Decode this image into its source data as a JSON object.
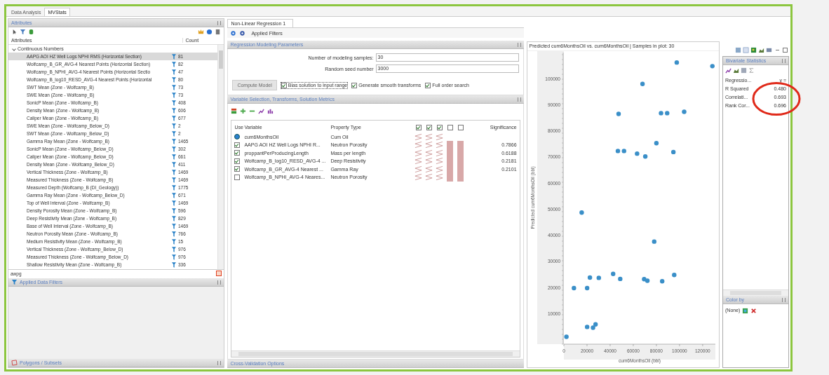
{
  "app_tabs": [
    {
      "label": "Data Analysis",
      "selected": false
    },
    {
      "label": "MVStats",
      "selected": true
    }
  ],
  "attributes_panel": {
    "title": "Attributes",
    "columns": [
      "Attributes",
      "Count"
    ],
    "group": "Continuous Numbers",
    "expanded": true,
    "rows": [
      {
        "name": "AAPG AOI HZ Well Logs NPHI RMS (Horizontal Section)",
        "count": "81",
        "selected": true
      },
      {
        "name": "Wolfcamp_B_GR_AVG-4 Nearest Points  (Horizontal Section)",
        "count": "82",
        "selected": false
      },
      {
        "name": "Wolfcamp_B_NPHI_AVG-4 Nearest Points  (Horizontal Sectio",
        "count": "47",
        "selected": false
      },
      {
        "name": "Wolfcamp_B_log10_RESD_AVG-4 Nearest Points  (Horizontal",
        "count": "80",
        "selected": false
      },
      {
        "name": "SWT Mean (Zone - Wolfcamp_B)",
        "count": "73",
        "selected": false
      },
      {
        "name": "SWE Mean (Zone - Wolfcamp_B)",
        "count": "73",
        "selected": false
      },
      {
        "name": "SonicP Mean (Zone - Wolfcamp_B)",
        "count": "408",
        "selected": false
      },
      {
        "name": "Density Mean (Zone - Wolfcamp_B)",
        "count": "606",
        "selected": false
      },
      {
        "name": "Caliper Mean (Zone - Wolfcamp_B)",
        "count": "677",
        "selected": false
      },
      {
        "name": "SWE Mean (Zone - Wolfcamp_Below_D)",
        "count": "2",
        "selected": false
      },
      {
        "name": "SWT Mean (Zone - Wolfcamp_Below_D)",
        "count": "2",
        "selected": false
      },
      {
        "name": "Gamma Ray Mean (Zone - Wolfcamp_B)",
        "count": "1465",
        "selected": false
      },
      {
        "name": "SonicP Mean (Zone - Wolfcamp_Below_D)",
        "count": "302",
        "selected": false
      },
      {
        "name": "Caliper Mean (Zone - Wolfcamp_Below_D)",
        "count": "661",
        "selected": false
      },
      {
        "name": "Density Mean (Zone - Wolfcamp_Below_D)",
        "count": "411",
        "selected": false
      },
      {
        "name": "Vertical Thickness (Zone - Wolfcamp_B)",
        "count": "1469",
        "selected": false
      },
      {
        "name": "Measured Thickness (Zone - Wolfcamp_B)",
        "count": "1469",
        "selected": false
      },
      {
        "name": "Measured Depth (Wolfcamp_B (DI_Geology))",
        "count": "1775",
        "selected": false
      },
      {
        "name": "Gamma Ray Mean (Zone - Wolfcamp_Below_D)",
        "count": "671",
        "selected": false
      },
      {
        "name": "Top of Well Interval (Zone - Wolfcamp_B)",
        "count": "1469",
        "selected": false
      },
      {
        "name": "Density Porosity Mean (Zone - Wolfcamp_B)",
        "count": "596",
        "selected": false
      },
      {
        "name": "Deep Resistivity Mean (Zone - Wolfcamp_B)",
        "count": "829",
        "selected": false
      },
      {
        "name": "Base of Well Interval (Zone - Wolfcamp_B)",
        "count": "1469",
        "selected": false
      },
      {
        "name": "Neutron Porosity Mean (Zone - Wolfcamp_B)",
        "count": "766",
        "selected": false
      },
      {
        "name": "Medium Resistivity Mean (Zone - Wolfcamp_B)",
        "count": "15",
        "selected": false
      },
      {
        "name": "Vertical Thickness (Zone - Wolfcamp_Below_D)",
        "count": "976",
        "selected": false
      },
      {
        "name": "Measured Thickness (Zone - Wolfcamp_Below_D)",
        "count": "976",
        "selected": false
      },
      {
        "name": "Shallow Resistivity Mean (Zone - Wolfcamp_B)",
        "count": "336",
        "selected": false
      }
    ],
    "filter": {
      "value": "awpg"
    }
  },
  "applied_data_filters": {
    "title": "Applied Data Filters"
  },
  "polygons_subsets": {
    "title": "Polygons / Subsets"
  },
  "document_tab": {
    "label": "Non-Linear Regression 1"
  },
  "toolbar": {
    "label": "Applied Filters"
  },
  "regression_parameters": {
    "title": "Regression Modeling Parameters",
    "fields": [
      {
        "label": "Number of modeling samples:",
        "value": "30"
      },
      {
        "label": "Random seed number",
        "value": "3000"
      }
    ],
    "compute_button": {
      "label": "Compute Model",
      "disabled": true
    },
    "options": [
      {
        "label": "Bias solution to input range",
        "checked": true
      },
      {
        "label": "Generate smooth transforms",
        "checked": true
      },
      {
        "label": "Full order search",
        "checked": true
      }
    ]
  },
  "variable_selection": {
    "title": "Variable Selection, Transforms, Solution Metrics",
    "columns": [
      "Use",
      "Variable",
      "Property Type",
      "Significance"
    ],
    "header_checks": [
      true,
      true,
      true,
      false,
      false
    ],
    "rows": [
      {
        "kind": "target",
        "variable": "cum6MonthsOil",
        "property": "Cum Oil",
        "cells": [
          {
            "kind": "wave"
          },
          {
            "kind": "wave"
          },
          {
            "kind": "wave"
          },
          {
            "kind": "blank"
          },
          {
            "kind": "blank"
          }
        ]
      },
      {
        "kind": "checkbox",
        "checked": true,
        "variable": "AAPG AOI HZ Well Logs NPHI R...",
        "property": "Neutron Porosity",
        "cells": [
          {
            "kind": "wave"
          },
          {
            "kind": "wave"
          },
          {
            "kind": "wave"
          },
          {
            "kind": "bar"
          },
          {
            "kind": "bar"
          }
        ],
        "significance": "0.7866"
      },
      {
        "kind": "checkbox",
        "checked": true,
        "variable": "proppantPerProducingLength",
        "property": "Mass per length",
        "cells": [
          {
            "kind": "wave"
          },
          {
            "kind": "wave"
          },
          {
            "kind": "wave"
          },
          {
            "kind": "bar"
          },
          {
            "kind": "bar"
          }
        ],
        "significance": "0.6188"
      },
      {
        "kind": "checkbox",
        "checked": true,
        "variable": "Wolfcamp_B_log10_RESD_AVG-4 ...",
        "property": "Deep Resistivity",
        "cells": [
          {
            "kind": "wave"
          },
          {
            "kind": "wave"
          },
          {
            "kind": "wave"
          },
          {
            "kind": "bar"
          },
          {
            "kind": "bar"
          }
        ],
        "significance": "0.2181"
      },
      {
        "kind": "checkbox",
        "checked": true,
        "variable": "Wolfcamp_B_GR_AVG-4 Nearest ...",
        "property": "Gamma Ray",
        "cells": [
          {
            "kind": "wave"
          },
          {
            "kind": "wave"
          },
          {
            "kind": "wave"
          },
          {
            "kind": "bar"
          },
          {
            "kind": "bar"
          }
        ],
        "significance": "0.2101"
      },
      {
        "kind": "checkbox",
        "checked": false,
        "variable": "Wolfcamp_B_NPHI_AVG-4 Neares...",
        "property": "Neutron Porosity",
        "cells": [
          {
            "kind": "wave"
          },
          {
            "kind": "wave"
          },
          {
            "kind": "wave"
          },
          {
            "kind": "bar"
          },
          {
            "kind": "bar"
          }
        ]
      }
    ]
  },
  "cross_validation": {
    "title": "Cross-Validation Options"
  },
  "plot": {
    "title": "Predicted cum6MonthsOil vs. cum6MonthsOil | Samples in plot: 30",
    "chart_data": {
      "type": "scatter",
      "xlabel": "cum6MonthsOil (bbl)",
      "ylabel": "Predicted cum6MonthsOil (bbl)",
      "x": [
        97600,
        128400,
        68000,
        47300,
        84000,
        89300,
        104000,
        46700,
        52000,
        63300,
        70400,
        80000,
        94700,
        15400,
        78100,
        8700,
        20100,
        22500,
        30200,
        42600,
        48700,
        69400,
        72200,
        85000,
        95400,
        20100,
        25200,
        27400,
        2200
      ],
      "series": [
        {
          "color": "#3a8fc8",
          "values": [
            106200,
            104800,
            98000,
            86500,
            86800,
            86800,
            87300,
            72300,
            72300,
            71300,
            70200,
            75300,
            71900,
            48700,
            37600,
            19800,
            19800,
            23800,
            23700,
            25200,
            23300,
            23200,
            22600,
            22400,
            24800,
            4900,
            4600,
            5900,
            1100
          ]
        }
      ],
      "xlim": [
        0,
        131000
      ],
      "ylim": [
        -1700,
        110000
      ],
      "xticks": [
        0,
        20000,
        40000,
        60000,
        80000,
        100000,
        120000
      ],
      "yticks": [
        10000,
        20000,
        30000,
        40000,
        50000,
        60000,
        70000,
        80000,
        90000,
        100000
      ]
    }
  },
  "bivariate_statistics": {
    "title": "Bivariate Statistics",
    "rows": [
      {
        "label": "Regressio...",
        "value": "y ="
      },
      {
        "label": "R Squared",
        "value": "0.480"
      },
      {
        "label": "Correlati...",
        "value": "0.693"
      },
      {
        "label": "Rank Cor...",
        "value": "0.696"
      }
    ]
  },
  "color_by": {
    "title": "Color by",
    "value": "(None)"
  }
}
